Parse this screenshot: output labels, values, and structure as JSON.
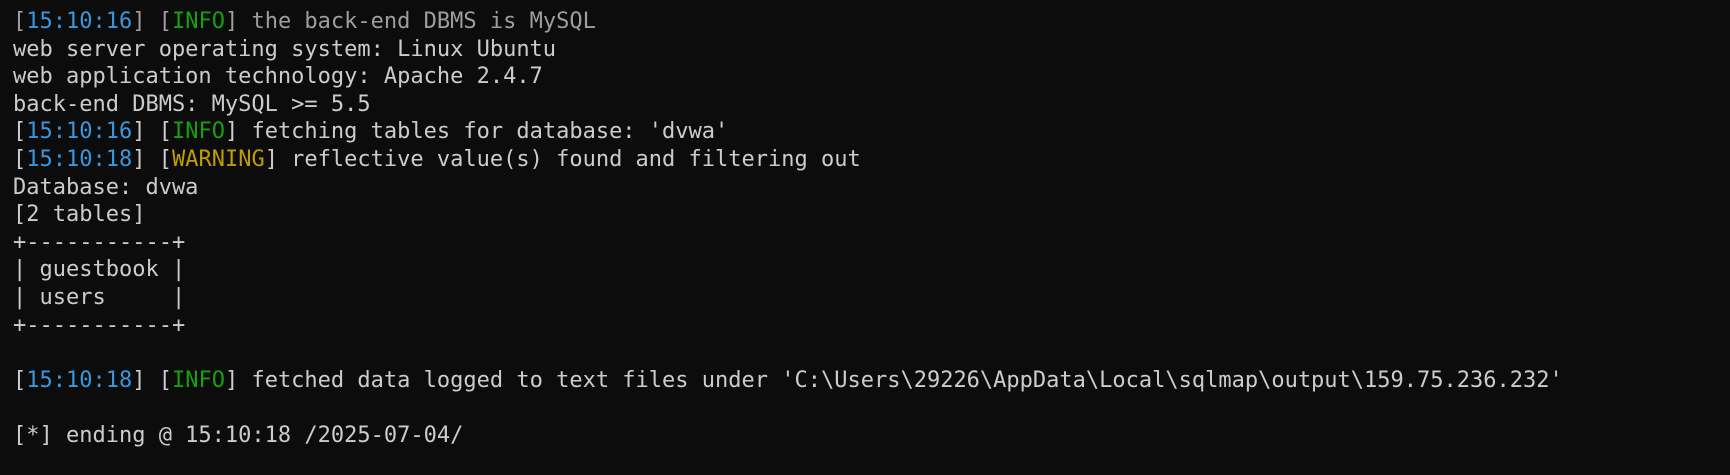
{
  "terminal": {
    "colors": {
      "background": "#0c0c0c",
      "text": "#cccccc",
      "timestamp": "#3a96dd",
      "info": "#13a10e",
      "warning": "#c19c00",
      "faded": "#9e9e9e"
    },
    "lines": [
      {
        "time": "15:10:16",
        "level": "INFO",
        "msg": " the back-end DBMS is MySQL"
      },
      {
        "text": "web server operating system: Linux Ubuntu"
      },
      {
        "text": "web application technology: Apache 2.4.7"
      },
      {
        "text": "back-end DBMS: MySQL >= 5.5"
      },
      {
        "time": "15:10:16",
        "level": "INFO",
        "msg": " fetching tables for database: 'dvwa'"
      },
      {
        "time": "15:10:18",
        "level": "WARNING",
        "msg": " reflective value(s) found and filtering out"
      },
      {
        "text": "Database: dvwa"
      },
      {
        "text": "[2 tables]"
      },
      {
        "text": "+-----------+"
      },
      {
        "text": "| guestbook |"
      },
      {
        "text": "| users     |"
      },
      {
        "text": "+-----------+"
      },
      {
        "text": ""
      },
      {
        "time": "15:10:18",
        "level": "INFO",
        "msg": " fetched data logged to text files under 'C:\\Users\\29226\\AppData\\Local\\sqlmap\\output\\159.75.236.232'"
      },
      {
        "text": ""
      },
      {
        "text": "[*] ending @ 15:10:18 /2025-07-04/"
      }
    ]
  }
}
